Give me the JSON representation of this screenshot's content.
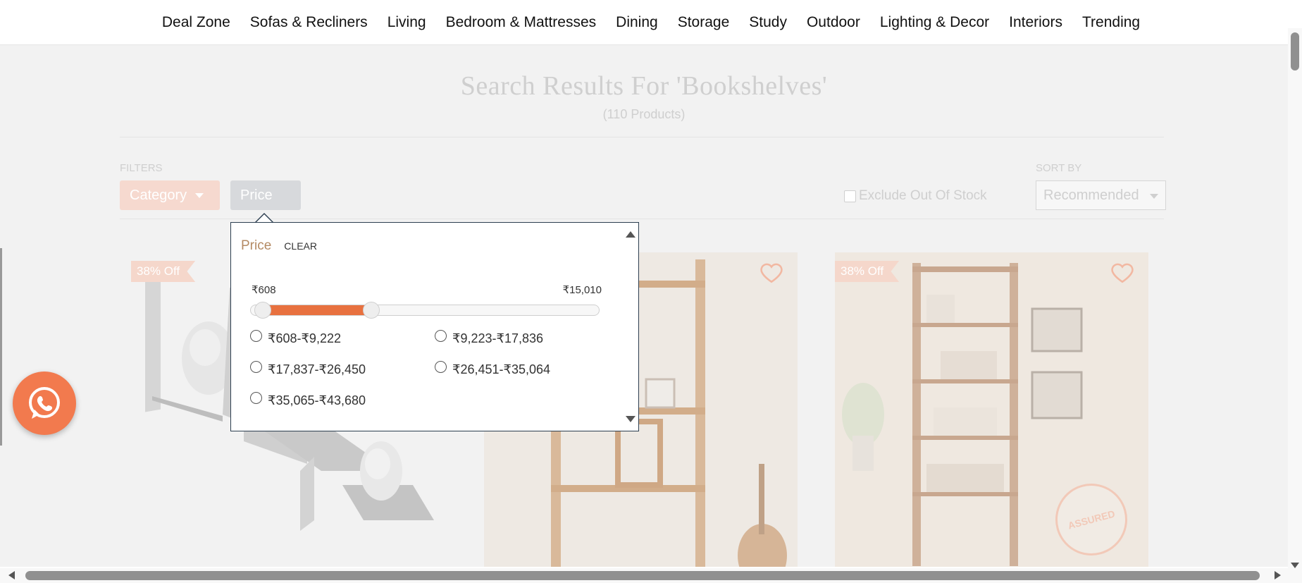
{
  "nav": {
    "items": [
      "Deal Zone",
      "Sofas & Recliners",
      "Living",
      "Bedroom & Mattresses",
      "Dining",
      "Storage",
      "Study",
      "Outdoor",
      "Lighting & Decor",
      "Interiors",
      "Trending"
    ]
  },
  "results": {
    "title": "Search Results For 'Bookshelves'",
    "count": "(110 Products)"
  },
  "filters": {
    "label": "FILTERS",
    "category_label": "Category",
    "price_label": "Price",
    "exclude_label": "Exclude Out Of Stock"
  },
  "sort": {
    "label": "SORT BY",
    "selected": "Recommended"
  },
  "products": [
    {
      "badge": "38% Off",
      "wishlist_icon": "heart-icon"
    },
    {
      "badge": "",
      "wishlist_icon": "heart-icon"
    },
    {
      "badge": "38% Off",
      "wishlist_icon": "heart-icon",
      "stamp": "ASSURED"
    }
  ],
  "price_popover": {
    "title": "Price",
    "clear_label": "CLEAR",
    "range_min": "₹608",
    "range_max": "₹15,010",
    "slider_fraction": 0.32,
    "options": [
      "₹608-₹9,222",
      "₹9,223-₹17,836",
      "₹17,837-₹26,450",
      "₹26,451-₹35,064",
      "₹35,065-₹43,680"
    ]
  },
  "colors": {
    "accent": "#e8713f",
    "price_title": "#b48a63",
    "whatsapp_bg": "#f27a4e"
  },
  "icons": {
    "whatsapp": "whatsapp-icon",
    "wishlist": "heart-icon"
  }
}
